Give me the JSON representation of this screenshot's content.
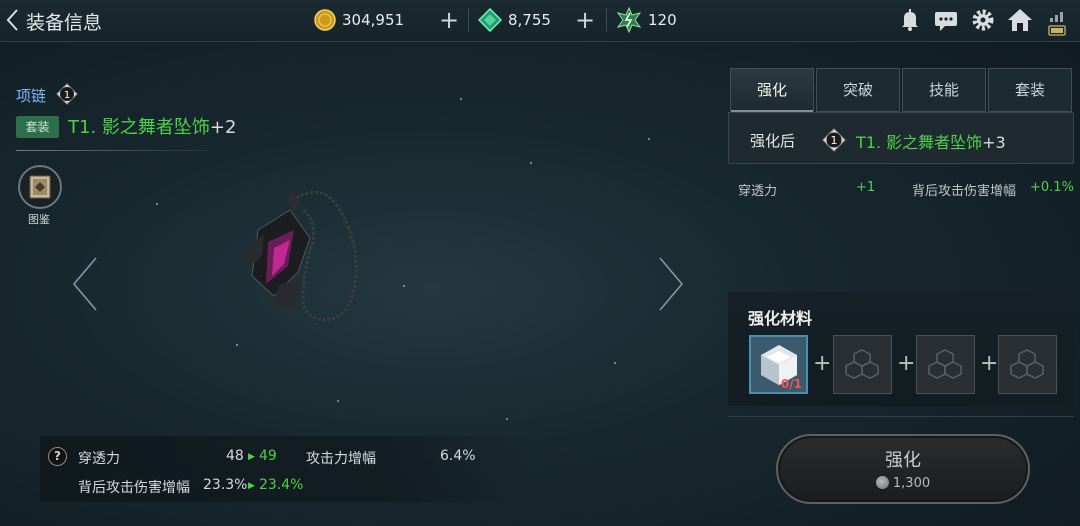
{
  "header": {
    "title": "装备信息",
    "currencies": [
      {
        "icon": "gold-coin-icon",
        "value": "304,951"
      },
      {
        "icon": "green-gem-icon",
        "value": "8,755"
      },
      {
        "icon": "energy-crystal-icon",
        "value": "120"
      }
    ]
  },
  "item": {
    "category": "项链",
    "grade": "1",
    "set_tag": "套装",
    "name": "T1. 影之舞者坠饰",
    "enhance": "+2"
  },
  "codex": {
    "label": "图鉴"
  },
  "stats": {
    "rows": [
      {
        "label": "穿透力",
        "value": "48",
        "next": "49"
      },
      {
        "label": "攻击力增幅",
        "value": "6.4%"
      },
      {
        "label": "背后攻击伤害增幅",
        "value": "23.3%",
        "next": "23.4%"
      }
    ]
  },
  "tabs": [
    "强化",
    "突破",
    "技能",
    "套装"
  ],
  "enhance_preview": {
    "label": "强化后",
    "grade": "1",
    "name": "T1. 影之舞者坠饰",
    "enhance": "+3",
    "gains": [
      {
        "label": "穿透力",
        "value": "+1"
      },
      {
        "label": "背后攻击伤害增幅",
        "value": "+0.1%"
      }
    ]
  },
  "materials": {
    "title": "强化材料",
    "slots": [
      {
        "state": "filled",
        "count": "0/1"
      },
      {
        "state": "empty"
      },
      {
        "state": "empty"
      },
      {
        "state": "empty"
      }
    ]
  },
  "action": {
    "label": "强化",
    "cost": "1,300"
  },
  "colors": {
    "green": "#4fd04a",
    "category_blue": "#7fb8ff",
    "cost_red": "#ff5050"
  }
}
